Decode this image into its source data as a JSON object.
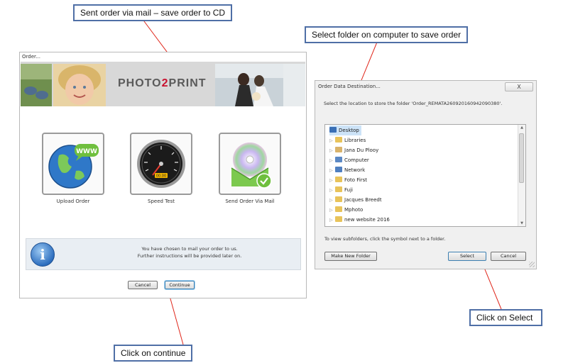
{
  "callouts": {
    "sent_order": "Sent order via mail – save order to CD",
    "select_folder": "Select folder on computer to save order",
    "click_continue": "Click on continue",
    "click_select": "Click on Select"
  },
  "order_window": {
    "title": "Order...",
    "logo_part1": "PHOTO",
    "logo_part2": "2",
    "logo_part3": "PRINT",
    "options": [
      {
        "label": "Upload Order",
        "icon": "globe-www-icon"
      },
      {
        "label": "Speed Test",
        "icon": "speedometer-icon"
      },
      {
        "label": "Send Order Via Mail",
        "icon": "cd-mail-icon"
      }
    ],
    "www_text": "WWW",
    "gauge_text": "00.00",
    "info_line1": "You have chosen to mail your order to us.",
    "info_line2": "Further instructions will be provided later on.",
    "info_glyph": "i",
    "cancel_label": "Cancel",
    "continue_label": "Continue"
  },
  "destination_window": {
    "title": "Order Data Destination...",
    "close_glyph": "X",
    "prompt": "Select the location to store the folder 'Order_REMATA2609201609420903​80'.",
    "folders": [
      {
        "label": "Desktop",
        "icon": "desktop-icon",
        "color": "#3a6fb5"
      },
      {
        "label": "Libraries",
        "icon": "libraries-icon",
        "color": "#e8c35a"
      },
      {
        "label": "Jana Du Plooy",
        "icon": "user-folder-icon",
        "color": "#d9b36a"
      },
      {
        "label": "Computer",
        "icon": "computer-icon",
        "color": "#5b88c4"
      },
      {
        "label": "Network",
        "icon": "network-icon",
        "color": "#4f7fc0"
      },
      {
        "label": "Foto First",
        "icon": "folder-icon",
        "color": "#e8c35a"
      },
      {
        "label": "Fuji",
        "icon": "folder-icon",
        "color": "#e8c35a"
      },
      {
        "label": "Jacques Breedt",
        "icon": "folder-icon",
        "color": "#e8c35a"
      },
      {
        "label": "Mphoto",
        "icon": "folder-icon",
        "color": "#e8c35a"
      },
      {
        "label": "new website 2016",
        "icon": "folder-icon",
        "color": "#e8c35a"
      }
    ],
    "hint": "To view subfolders, click the symbol next to a folder.",
    "new_folder_label": "Make New Folder",
    "select_label": "Select",
    "cancel_label": "Cancel"
  },
  "colors": {
    "callout_border": "#4f6fa6",
    "pointer_line": "#e0271b",
    "logo_accent": "#c8102e"
  }
}
